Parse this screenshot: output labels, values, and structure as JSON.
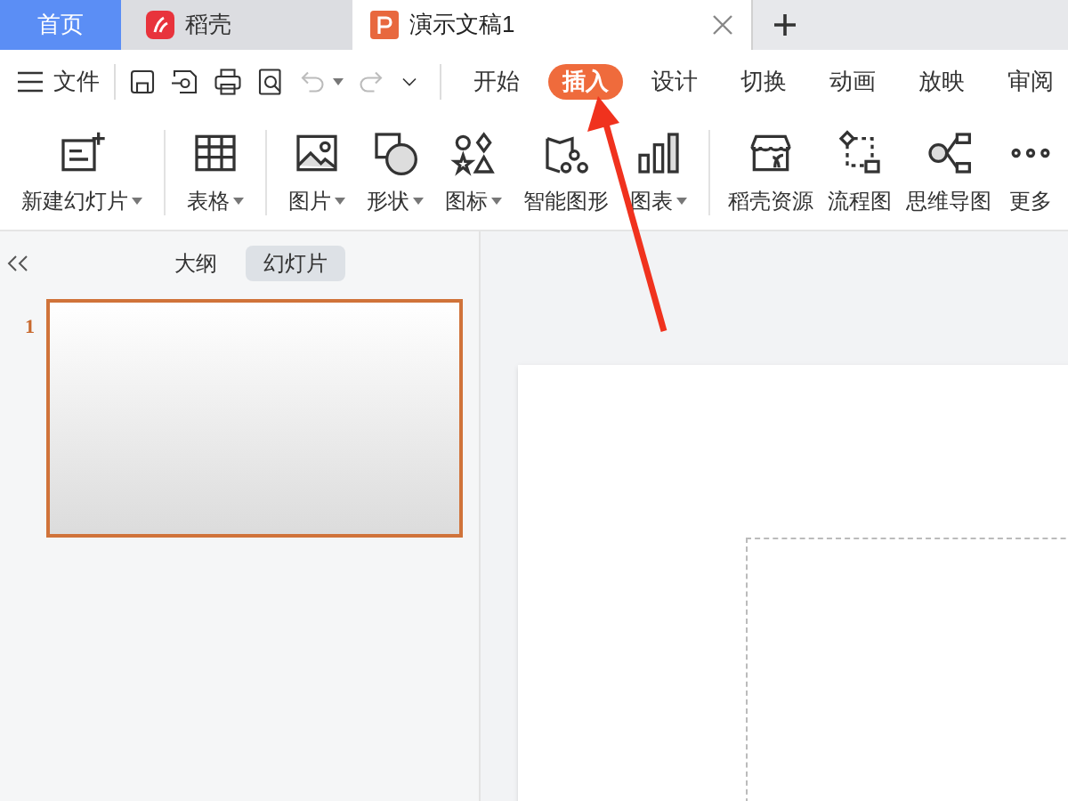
{
  "tabs": [
    {
      "kind": "home",
      "label": "首页",
      "selected": false
    },
    {
      "kind": "app",
      "label": "稻壳",
      "selected": false
    },
    {
      "kind": "document",
      "label": "演示文稿1",
      "selected": true
    }
  ],
  "menu": {
    "label": "文件"
  },
  "quick_tools": [
    {
      "disabled": false,
      "dropdown": false
    },
    {
      "disabled": false,
      "dropdown": false
    },
    {
      "disabled": false,
      "dropdown": false
    },
    {
      "disabled": false,
      "dropdown": false
    },
    {
      "disabled": true,
      "dropdown": true
    },
    {
      "disabled": true,
      "dropdown": false
    },
    {
      "disabled": false,
      "dropdown": false
    }
  ],
  "ribbon_tabs": [
    {
      "label": "开始",
      "selected": false
    },
    {
      "label": "插入",
      "selected": true
    },
    {
      "label": "设计",
      "selected": false
    },
    {
      "label": "切换",
      "selected": false
    },
    {
      "label": "动画",
      "selected": false
    },
    {
      "label": "放映",
      "selected": false
    },
    {
      "label": "审阅",
      "selected": false
    }
  ],
  "ribbon_groups": [
    [
      {
        "label": "新建幻灯片",
        "dropdown": true
      }
    ],
    [
      {
        "label": "表格",
        "dropdown": true
      }
    ],
    [
      {
        "label": "图片",
        "dropdown": true
      },
      {
        "label": "形状",
        "dropdown": true
      },
      {
        "label": "图标",
        "dropdown": true
      },
      {
        "label": "智能图形",
        "dropdown": false
      },
      {
        "label": "图表",
        "dropdown": true
      }
    ],
    [
      {
        "label": "稻壳资源",
        "dropdown": false
      },
      {
        "label": "流程图",
        "dropdown": false
      },
      {
        "label": "思维导图",
        "dropdown": false
      },
      {
        "label": "更多",
        "dropdown": false
      }
    ]
  ],
  "panel_tabs": [
    {
      "label": "大纲",
      "selected": false
    },
    {
      "label": "幻灯片",
      "selected": true
    }
  ],
  "slides": [
    {
      "number": "1",
      "selected": true
    }
  ]
}
